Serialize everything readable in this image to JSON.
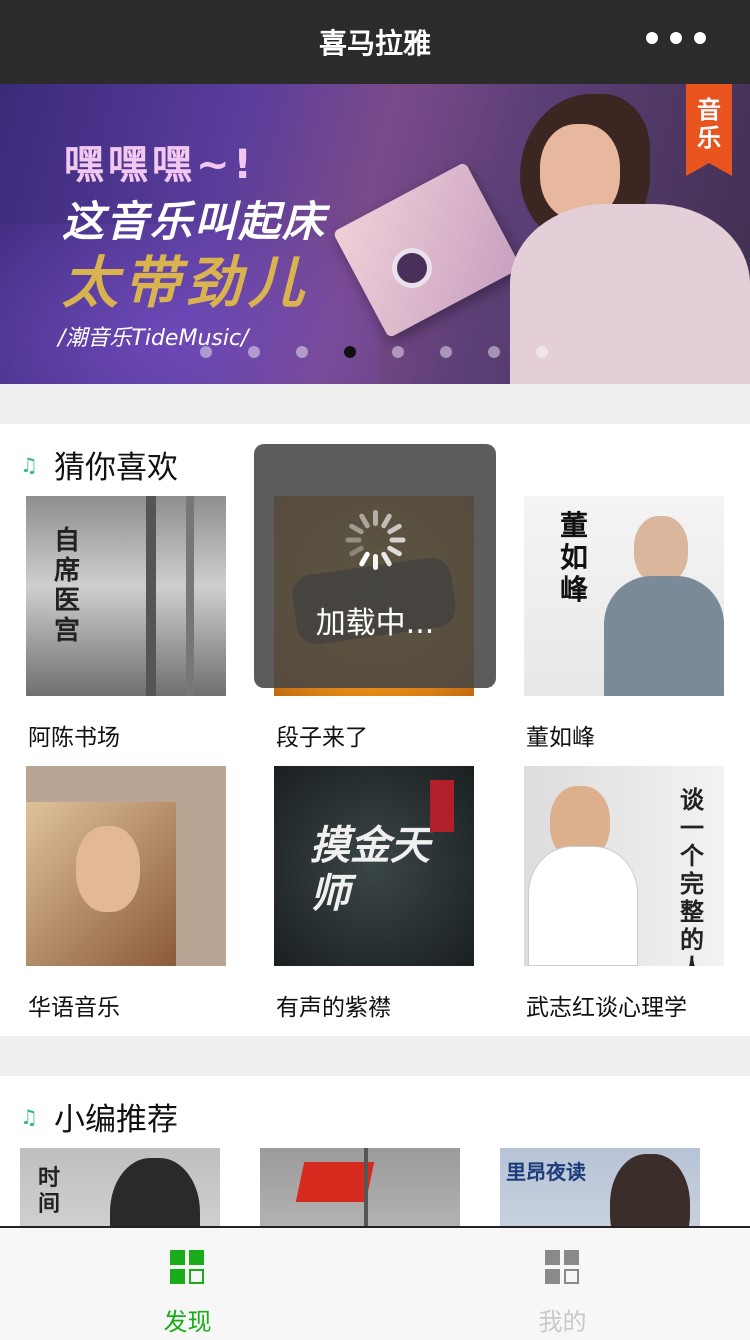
{
  "header": {
    "title": "喜马拉雅"
  },
  "banner": {
    "line1": "嘿嘿嘿~!",
    "line2": "这音乐叫起床",
    "line3": "太带劲儿",
    "line4": "/潮音乐TideMusic/",
    "tag": "音乐",
    "slides": 8,
    "active_slide": 4
  },
  "guess": {
    "title": "猜你喜欢",
    "items": [
      {
        "name": "阿陈书场",
        "cover_text": "自席医宫"
      },
      {
        "name": "段子来了",
        "cover_text": ""
      },
      {
        "name": "董如峰",
        "cover_text": "董如峰"
      },
      {
        "name": "华语音乐",
        "cover_text": ""
      },
      {
        "name": "有声的紫襟",
        "cover_text": "摸金天师"
      },
      {
        "name": "武志红谈心理学",
        "cover_text": "谈一个完整的人"
      }
    ]
  },
  "editor": {
    "title": "小编推荐",
    "covers": [
      {
        "cover_text": "时间"
      },
      {
        "cover_text": ""
      },
      {
        "cover_text": "里昂夜读"
      }
    ]
  },
  "loading": {
    "text": "加载中..."
  },
  "tabs": [
    {
      "label": "发现",
      "active": true
    },
    {
      "label": "我的",
      "active": false
    }
  ],
  "colors": {
    "topbar": "#2b2b2b",
    "accent": "#1aad19",
    "inactive": "#c9c9c9",
    "note_icon": "#3ab68a",
    "banner_tag": "#e8531e"
  },
  "icons": {
    "more": "more-dots-icon",
    "note": "music-note-icon",
    "discover": "grid-icon",
    "mine": "grid-icon",
    "loading": "spinner-icon"
  }
}
